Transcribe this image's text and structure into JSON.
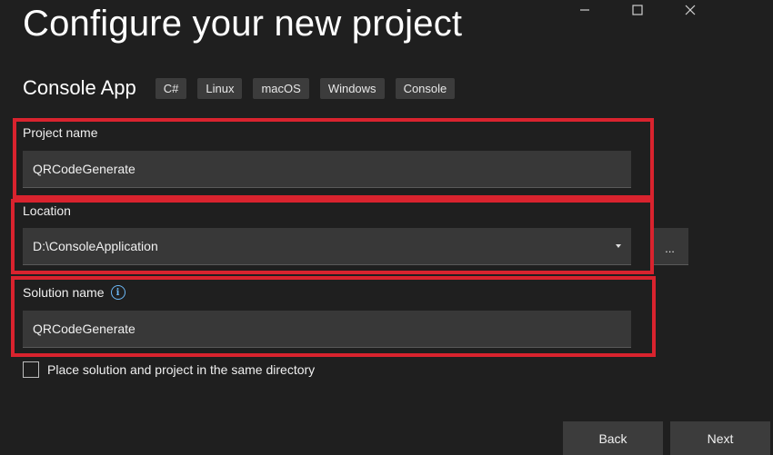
{
  "window": {
    "title": "Configure your new project",
    "controls": {
      "minimize": "—",
      "maximize": "☐",
      "close": "✕"
    }
  },
  "template": {
    "name": "Console App",
    "tags": [
      "C#",
      "Linux",
      "macOS",
      "Windows",
      "Console"
    ]
  },
  "fields": {
    "project_name": {
      "label": "Project name",
      "value": "QRCodeGenerate"
    },
    "location": {
      "label": "Location",
      "value": "D:\\ConsoleApplication",
      "browse_label": "..."
    },
    "solution_name": {
      "label": "Solution name",
      "value": "QRCodeGenerate",
      "info_glyph": "i"
    }
  },
  "options": {
    "same_directory": {
      "label": "Place solution and project in the same directory",
      "checked": false
    }
  },
  "footer": {
    "back_label": "Back",
    "next_label": "Next"
  },
  "colors": {
    "background": "#1f1f1f",
    "input_background": "#383838",
    "highlight": "#d9232e",
    "info_icon": "#6cb8f6"
  },
  "icons": {
    "dropdown": "chevron-down-icon",
    "info": "info-icon",
    "minimize": "minimize-icon",
    "maximize": "maximize-icon",
    "close": "close-icon"
  }
}
